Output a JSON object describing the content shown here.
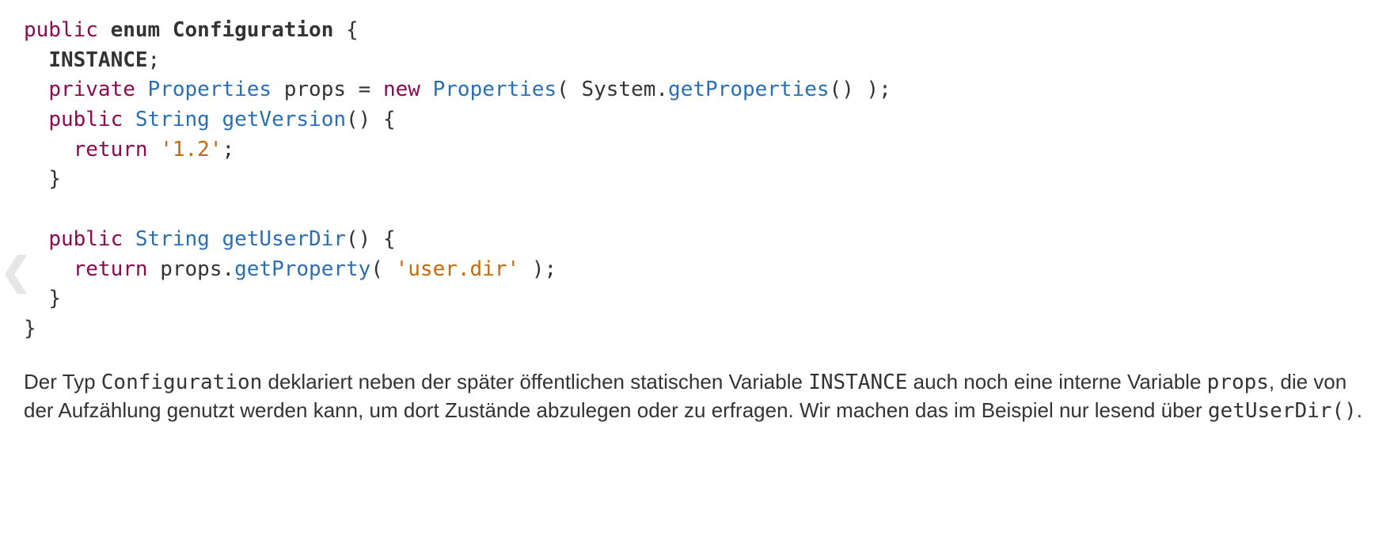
{
  "code": {
    "l1": {
      "kw1": "public",
      "kw2": "enum",
      "name": "Configuration",
      "brace": " {"
    },
    "l2": {
      "name": "INSTANCE",
      "semi": ";"
    },
    "l3": {
      "vis": "private",
      "type": "Properties",
      "var": " props = ",
      "new": "new",
      "ctor": "Properties",
      "arg_pre": "( System.",
      "call": "getProperties",
      "arg_post": "() );"
    },
    "l4": {
      "vis": "public",
      "type": "String",
      "sp": " ",
      "method": "getVersion",
      "rest": "() {"
    },
    "l5": {
      "kw": "return",
      "sp": " ",
      "str": "'1.2'",
      "semi": ";"
    },
    "l6": {
      "brace": "}"
    },
    "l8": {
      "vis": "public",
      "type": "String",
      "sp": " ",
      "method": "getUserDir",
      "rest": "() {"
    },
    "l9": {
      "kw": "return",
      "pre": " props.",
      "call": "getProperty",
      "mid": "( ",
      "str": "'user.dir'",
      "post": " );"
    },
    "l10": {
      "brace": "}"
    },
    "l11": {
      "brace": "}"
    }
  },
  "para": {
    "t1": "Der Typ ",
    "c1": "Configuration",
    "t2": " deklariert neben der später öffentlichen statischen Variable ",
    "c2": "INSTANCE",
    "t3": " auch noch eine interne Variable ",
    "c3": "props",
    "t4": ", die von der Aufzählung genutzt werden kann, um dort Zustände abzulegen oder zu erfragen. Wir machen das im Beispiel nur lesend über ",
    "c4": "getUserDir()",
    "t5": "."
  },
  "chevron": "❮"
}
